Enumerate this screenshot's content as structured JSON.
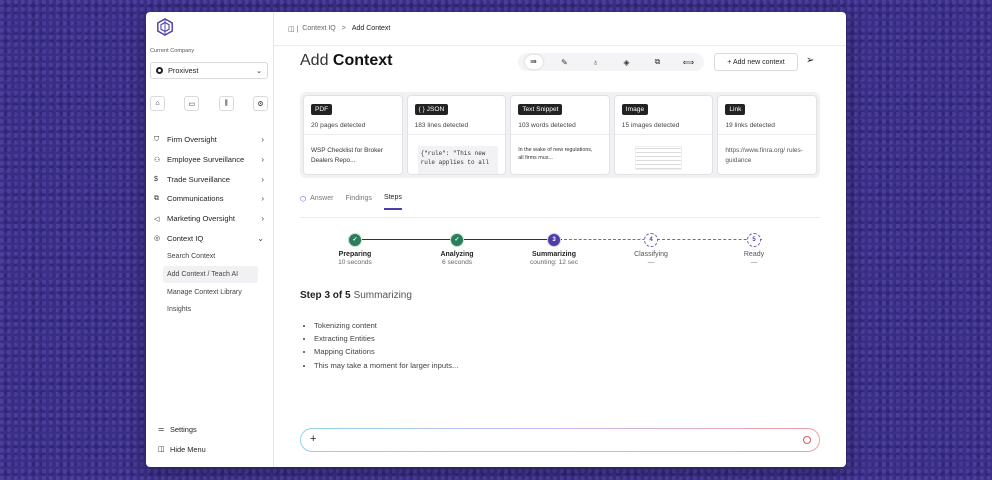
{
  "breadcrumb": {
    "parent": "Context IQ",
    "current": "Add Context"
  },
  "page_title": {
    "prefix": "Add",
    "bold": "Context"
  },
  "toolbar": {
    "icons": [
      "list-icon",
      "edit-icon",
      "bulb-icon",
      "layers-icon",
      "chat-icon",
      "move-icon"
    ],
    "add_button": "+ Add new context"
  },
  "sidebar": {
    "company_label": "Current Company",
    "company": "Proxivest",
    "nav": [
      {
        "label": "Firm Oversight",
        "icon": "shield-icon"
      },
      {
        "label": "Employee Surveillance",
        "icon": "users-icon"
      },
      {
        "label": "Trade Surveillance",
        "icon": "dollar-icon"
      },
      {
        "label": "Communications",
        "icon": "chat-icon"
      },
      {
        "label": "Marketing Oversight",
        "icon": "megaphone-icon"
      },
      {
        "label": "Context IQ",
        "icon": "context-icon"
      }
    ],
    "subnav": [
      "Search Context",
      "Add Context / Teach AI",
      "Manage Context Library",
      "Insights"
    ],
    "bottom": {
      "settings": "Settings",
      "hide": "Hide Menu"
    }
  },
  "cards": [
    {
      "tag": "PDF",
      "meta": "20 pages detected",
      "preview": "WSP Checklist for Broker Dealers Repo..."
    },
    {
      "tag": "{ } JSON",
      "meta": "183 lines detected",
      "preview": "{\"rule\": \"This new rule applies to all"
    },
    {
      "tag": "Text Snippet",
      "meta": "103 words detected",
      "preview": "In the wake of new regulations, all firms mus..."
    },
    {
      "tag": "Image",
      "meta": "15 images detected",
      "preview": ""
    },
    {
      "tag": "Link",
      "meta": "19 links detected",
      "preview": "https://www.finra.org/ rules-guidance"
    }
  ],
  "tabs": [
    "Answer",
    "Findings",
    "Steps"
  ],
  "steps": [
    {
      "num": "",
      "name": "Preparing",
      "sub": "10 seconds"
    },
    {
      "num": "",
      "name": "Analyzing",
      "sub": "6 seconds"
    },
    {
      "num": "3",
      "name": "Summarizing",
      "sub": "counting: 12 sec"
    },
    {
      "num": "4",
      "name": "Classifying",
      "sub": "—"
    },
    {
      "num": "5",
      "name": "Ready",
      "sub": "—"
    }
  ],
  "step_heading": {
    "bold": "Step 3 of 5",
    "light": "Summarizing"
  },
  "bullets": [
    "Tokenizing content",
    "Extracting Entities",
    "Mapping Citations",
    "This may take a moment for larger inputs..."
  ],
  "chat": {
    "placeholder": ""
  }
}
